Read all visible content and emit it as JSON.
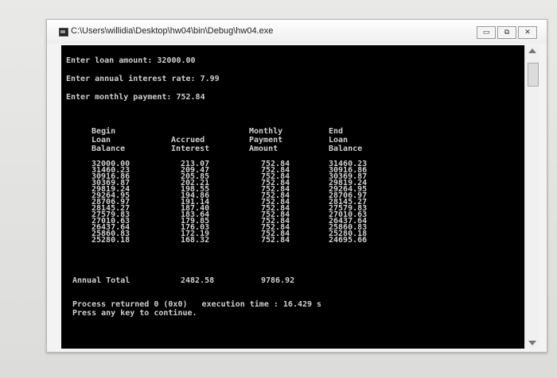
{
  "window": {
    "title": "C:\\Users\\willidia\\Desktop\\hw04\\bin\\Debug\\hw04.exe",
    "minimize_glyph": "▭",
    "restore_glyph": "⧉",
    "close_glyph": "✕"
  },
  "console": {
    "prompt_loan": "Enter loan amount: 32000.00",
    "prompt_rate": "Enter annual interest rate: 7.99",
    "prompt_payment": "Enter monthly payment: 752.84",
    "headers": {
      "begin": "Begin\nLoan\nBalance",
      "accrued": "Accrued\nInterest",
      "monthly": "Monthly\nPayment\nAmount",
      "end": "End\nLoan\nBalance"
    },
    "rows": [
      {
        "begin": "32000.00",
        "interest": "213.07",
        "payment": "752.84",
        "end": "31460.23"
      },
      {
        "begin": "31460.23",
        "interest": "209.47",
        "payment": "752.84",
        "end": "30916.86"
      },
      {
        "begin": "30916.86",
        "interest": "205.85",
        "payment": "752.84",
        "end": "30369.87"
      },
      {
        "begin": "30369.87",
        "interest": "202.21",
        "payment": "752.84",
        "end": "29819.24"
      },
      {
        "begin": "29819.24",
        "interest": "198.55",
        "payment": "752.84",
        "end": "29264.95"
      },
      {
        "begin": "29264.95",
        "interest": "194.86",
        "payment": "752.84",
        "end": "28706.97"
      },
      {
        "begin": "28706.97",
        "interest": "191.14",
        "payment": "752.84",
        "end": "28145.27"
      },
      {
        "begin": "28145.27",
        "interest": "187.40",
        "payment": "752.84",
        "end": "27579.83"
      },
      {
        "begin": "27579.83",
        "interest": "183.64",
        "payment": "752.84",
        "end": "27010.63"
      },
      {
        "begin": "27010.63",
        "interest": "179.85",
        "payment": "752.84",
        "end": "26437.64"
      },
      {
        "begin": "26437.64",
        "interest": "176.03",
        "payment": "752.84",
        "end": "25860.83"
      },
      {
        "begin": "25860.83",
        "interest": "172.19",
        "payment": "752.84",
        "end": "25280.18"
      },
      {
        "begin": "25280.18",
        "interest": "168.32",
        "payment": "752.84",
        "end": "24695.66"
      }
    ],
    "total_label": "Annual Total",
    "total_interest": "2482.58",
    "total_payment": "9786.92",
    "process_line": "Process returned 0 (0x0)   execution time : 16.429 s",
    "continue_line": "Press any key to continue."
  }
}
